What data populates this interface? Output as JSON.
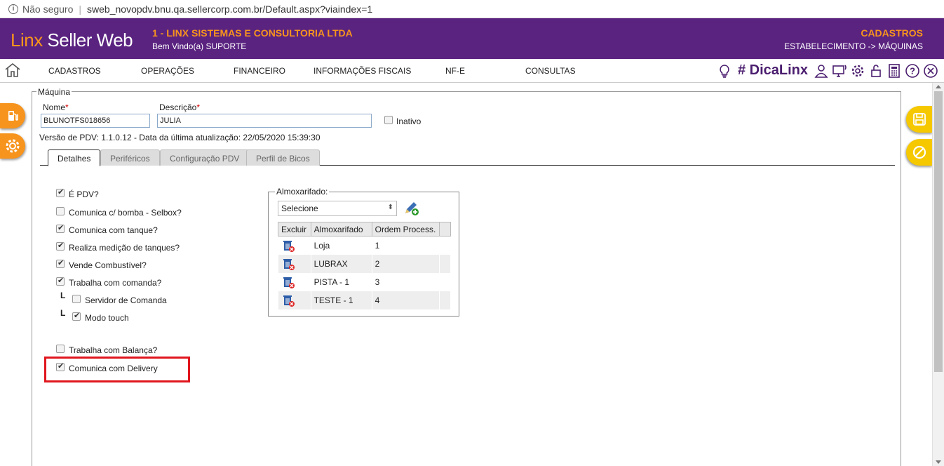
{
  "browser": {
    "security": "Não seguro",
    "url": "sweb_novopdv.bnu.qa.sellercorp.com.br/Default.aspx?viaindex=1"
  },
  "header": {
    "logo_linx": "Linx",
    "logo_rest": " Seller Web",
    "company": "1 - LINX SISTEMAS E CONSULTORIA LTDA",
    "welcome": "Bem Vindo(a) SUPORTE",
    "section": "CADASTROS",
    "breadcrumb": "ESTABELECIMENTO -> MÁQUINAS"
  },
  "menu": {
    "items": [
      "CADASTROS",
      "OPERAÇÕES",
      "FINANCEIRO",
      "INFORMAÇÕES FISCAIS",
      "NF-E",
      "CONSULTAS"
    ],
    "dica": "# DicaLinx"
  },
  "form": {
    "legend": "Máquina",
    "nome_label": "Nome",
    "nome_value": "BLUNOTFS018656",
    "descricao_label": "Descrição",
    "descricao_value": "JULIA",
    "req_mark": "*",
    "inativo_label": "Inativo",
    "versao": "Versão de PDV: 1.1.0.12 - Data da última atualização: 22/05/2020 15:39:30"
  },
  "tabs": [
    "Detalhes",
    "Periféricos",
    "Configuração PDV",
    "Perfil de Bicos"
  ],
  "options": [
    {
      "label": "É PDV?",
      "checked": true
    },
    {
      "label": "Comunica c/ bomba - Selbox?",
      "checked": false
    },
    {
      "label": "Comunica com tanque?",
      "checked": true
    },
    {
      "label": "Realiza medição de tanques?",
      "checked": true
    },
    {
      "label": "Vende Combustível?",
      "checked": true
    },
    {
      "label": "Trabalha com comanda?",
      "checked": true
    },
    {
      "label": "Servidor de Comanda",
      "checked": false
    },
    {
      "label": "Modo touch",
      "checked": true
    },
    {
      "label": "Trabalha com Balança?",
      "checked": false
    },
    {
      "label": "Comunica com Delivery",
      "checked": true
    }
  ],
  "tree_mark": "L",
  "almoxarifado": {
    "legend": "Almoxarifado:",
    "select_value": "Selecione",
    "columns": [
      "Excluir",
      "Almoxarifado",
      "Ordem Process."
    ],
    "rows": [
      {
        "name": "Loja",
        "order": "1"
      },
      {
        "name": "LUBRAX",
        "order": "2"
      },
      {
        "name": "PISTA - 1",
        "order": "3"
      },
      {
        "name": "TESTE - 1",
        "order": "4"
      }
    ]
  },
  "colors": {
    "header_bg": "#5a2380",
    "accent": "#f7941d",
    "save_btn": "#f5c800",
    "highlight": "#e0161e"
  }
}
